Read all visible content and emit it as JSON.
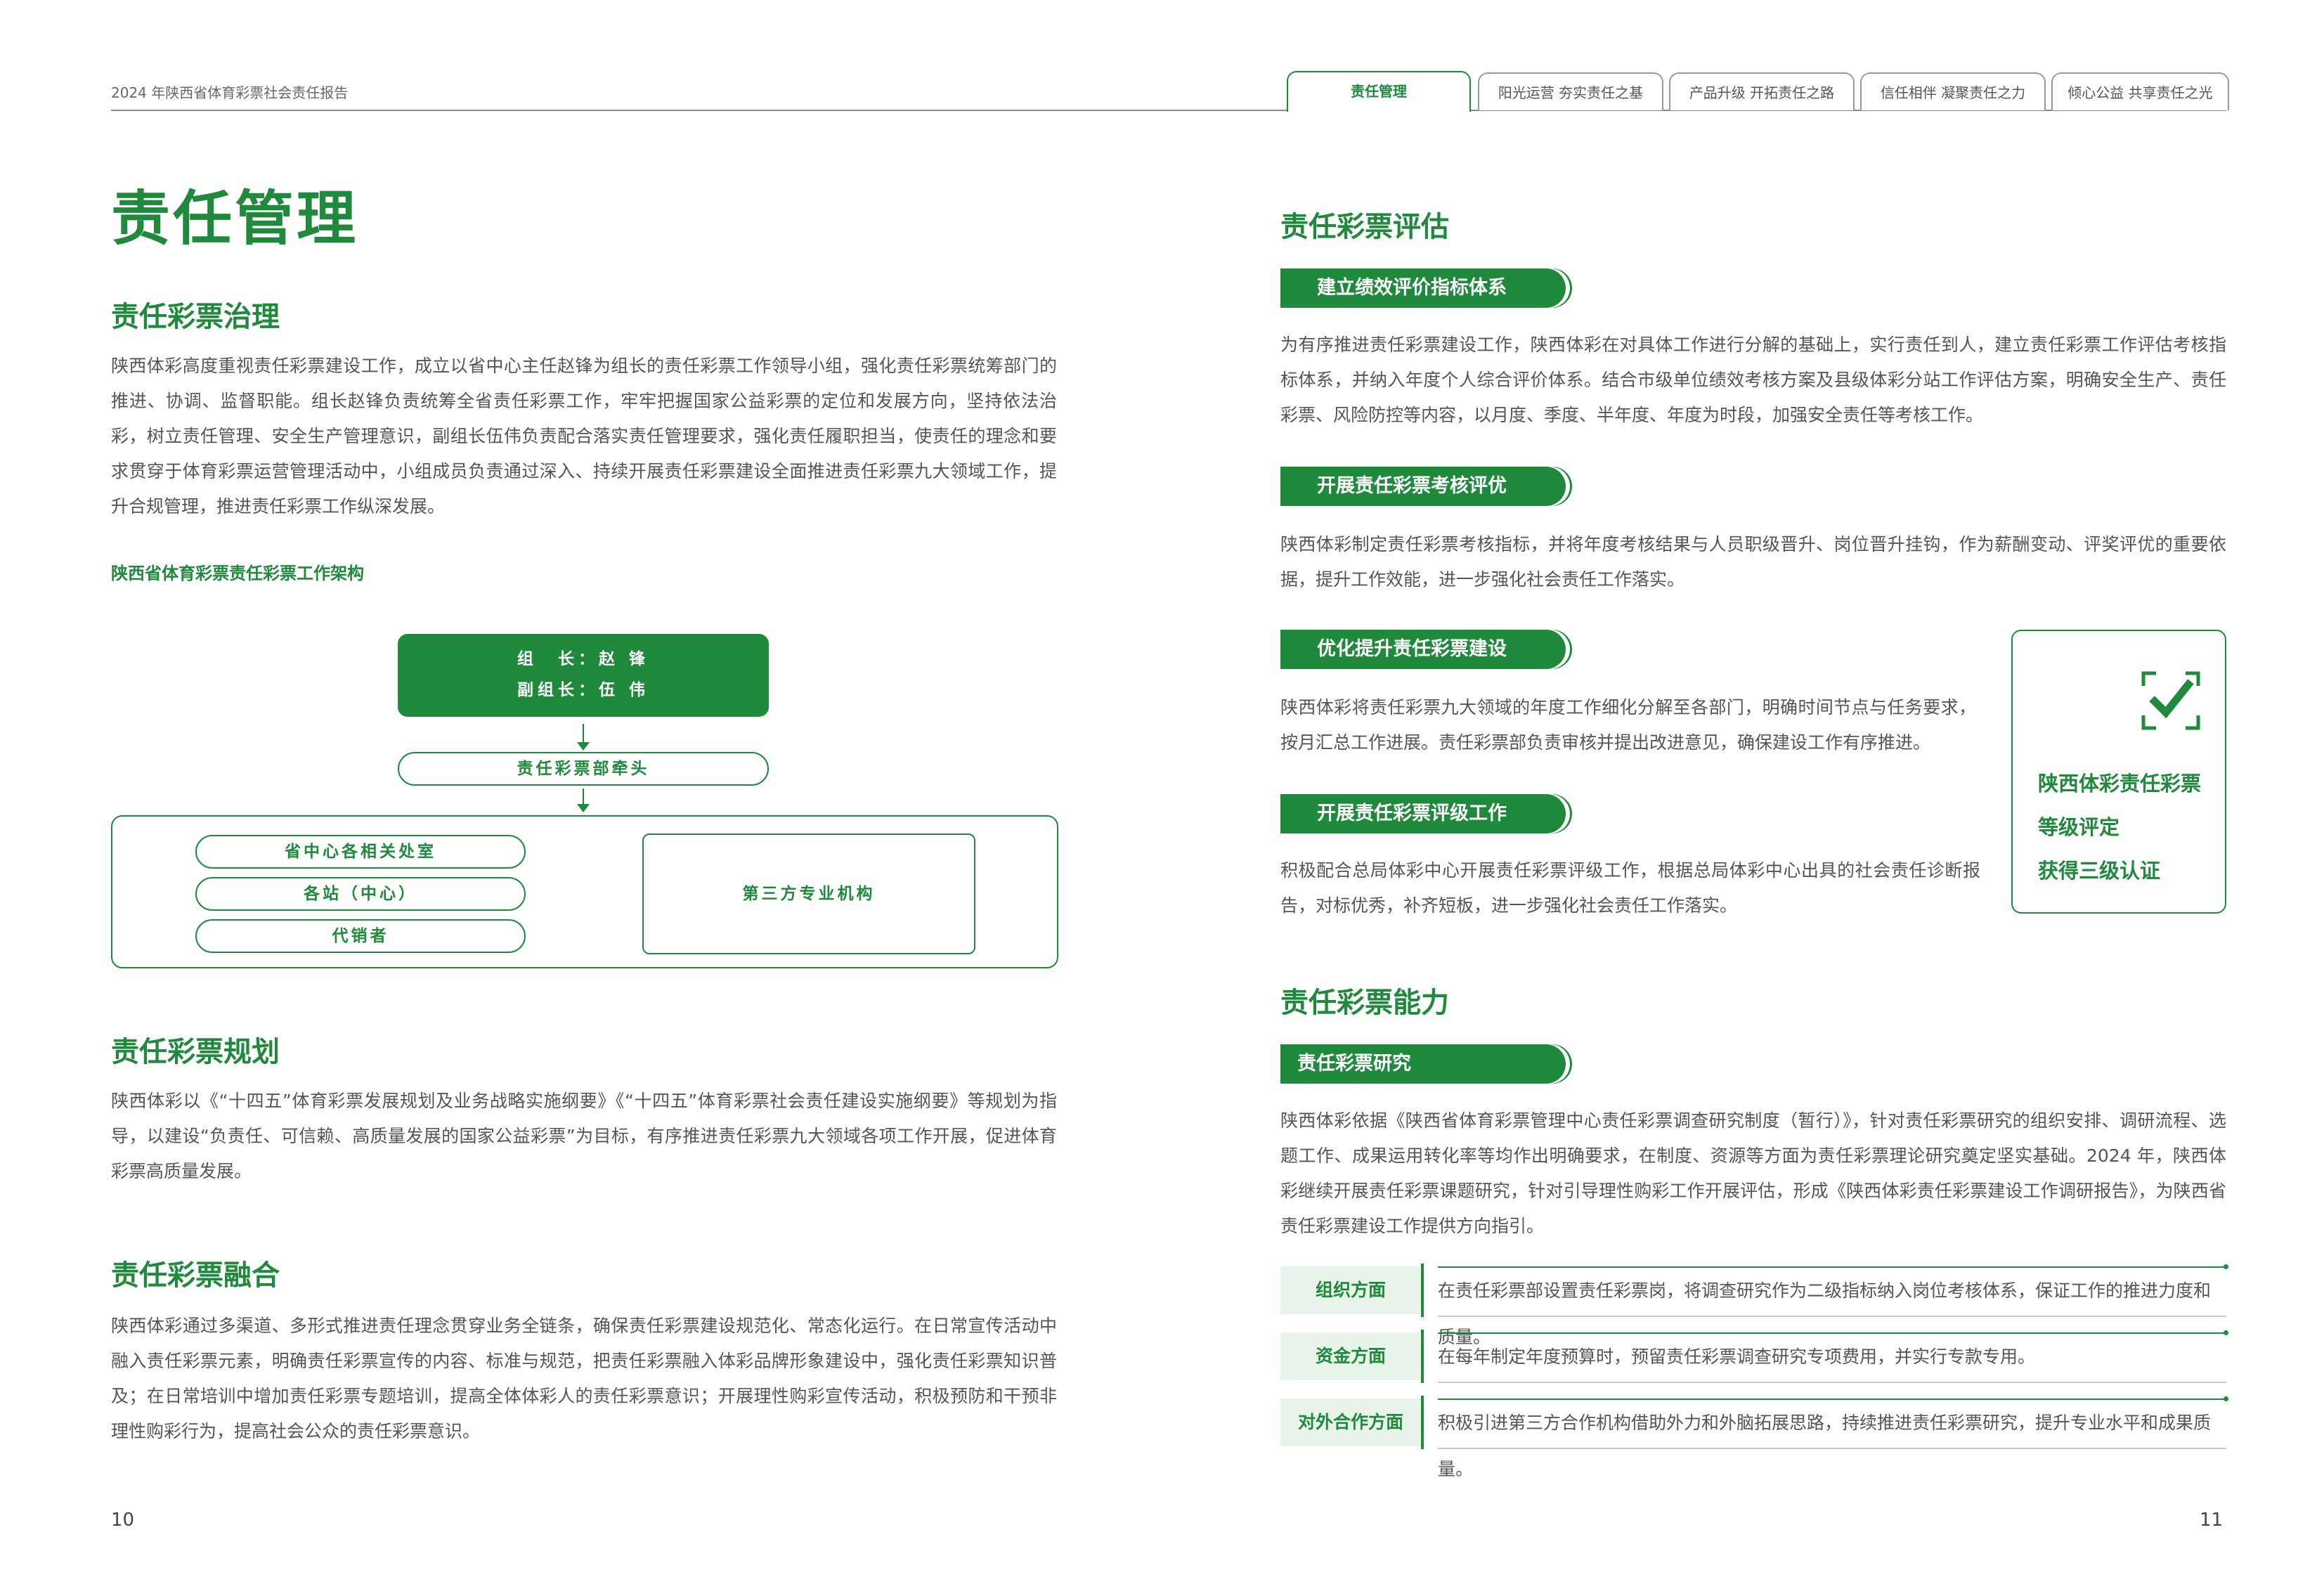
{
  "header": {
    "report_title": "2024 年陕西省体育彩票社会责任报告",
    "tabs": [
      {
        "label": "责任管理",
        "active": true
      },
      {
        "label": "阳光运营  夯实责任之基",
        "active": false
      },
      {
        "label": "产品升级  开拓责任之路",
        "active": false
      },
      {
        "label": "信任相伴  凝聚责任之力",
        "active": false
      },
      {
        "label": "倾心公益  共享责任之光",
        "active": false
      }
    ]
  },
  "left": {
    "page_title": "责任管理",
    "governance": {
      "heading": "责任彩票治理",
      "paragraph": "陕西体彩高度重视责任彩票建设工作，成立以省中心主任赵锋为组长的责任彩票工作领导小组，强化责任彩票统筹部门的推进、协调、监督职能。组长赵锋负责统筹全省责任彩票工作，牢牢把握国家公益彩票的定位和发展方向，坚持依法治彩，树立责任管理、安全生产管理意识，副组长伍伟负责配合落实责任管理要求，强化责任履职担当，使责任的理念和要求贯穿于体育彩票运营管理活动中，小组成员负责通过深入、持续开展责任彩票建设全面推进责任彩票九大领域工作，提升合规管理，推进责任彩票工作纵深发展。",
      "chart_caption": "陕西省体育彩票责任彩票工作架构",
      "org": {
        "leader": "组　长：赵 锋",
        "deputy": "副组长：伍 伟",
        "lead_dept": "责任彩票部牵头",
        "units": [
          "省中心各相关处室",
          "各站（中心）",
          "代销者"
        ],
        "third_party": "第三方专业机构"
      }
    },
    "planning": {
      "heading": "责任彩票规划",
      "paragraph": "陕西体彩以《“十四五”体育彩票发展规划及业务战略实施纲要》《“十四五”体育彩票社会责任建设实施纲要》等规划为指导，以建设“负责任、可信赖、高质量发展的国家公益彩票”为目标，有序推进责任彩票九大领域各项工作开展，促进体育彩票高质量发展。"
    },
    "integration": {
      "heading": "责任彩票融合",
      "paragraph": "陕西体彩通过多渠道、多形式推进责任理念贯穿业务全链条，确保责任彩票建设规范化、常态化运行。在日常宣传活动中融入责任彩票元素，明确责任彩票宣传的内容、标准与规范，把责任彩票融入体彩品牌形象建设中，强化责任彩票知识普及；在日常培训中增加责任彩票专题培训，提高全体体彩人的责任彩票意识；开展理性购彩宣传活动，积极预防和干预非理性购彩行为，提高社会公众的责任彩票意识。"
    },
    "page_number": "10"
  },
  "right": {
    "evaluation": {
      "heading": "责任彩票评估",
      "items": [
        {
          "title": "建立绩效评价指标体系",
          "text": "为有序推进责任彩票建设工作，陕西体彩在对具体工作进行分解的基础上，实行责任到人，建立责任彩票工作评估考核指标体系，并纳入年度个人综合评价体系。结合市级单位绩效考核方案及县级体彩分站工作评估方案，明确安全生产、责任彩票、风险防控等内容，以月度、季度、半年度、年度为时段，加强安全责任等考核工作。"
        },
        {
          "title": "开展责任彩票考核评优",
          "text": "陕西体彩制定责任彩票考核指标，并将年度考核结果与人员职级晋升、岗位晋升挂钩，作为薪酬变动、评奖评优的重要依据，提升工作效能，进一步强化社会责任工作落实。"
        },
        {
          "title": "优化提升责任彩票建设",
          "text": "陕西体彩将责任彩票九大领域的年度工作细化分解至各部门，明确时间节点与任务要求，按月汇总工作进展。责任彩票部负责审核并提出改进意见，确保建设工作有序推进。"
        },
        {
          "title": "开展责任彩票评级工作",
          "text": "积极配合总局体彩中心开展责任彩票评级工作，根据总局体彩中心出具的社会责任诊断报告，对标优秀，补齐短板，进一步强化社会责任工作落实。"
        }
      ],
      "cert": {
        "icon": "check-scan-icon",
        "lines": [
          "陕西体彩责任彩票",
          "等级评定",
          "获得三级认证"
        ]
      }
    },
    "capability": {
      "heading": "责任彩票能力",
      "pill": "责任彩票研究",
      "paragraph": "陕西体彩依据《陕西省体育彩票管理中心责任彩票调查研究制度（暂行）》，针对责任彩票研究的组织安排、调研流程、选题工作、成果运用转化率等均作出明确要求，在制度、资源等方面为责任彩票理论研究奠定坚实基础。2024 年，陕西体彩继续开展责任彩票课题研究，针对引导理性购彩工作开展评估，形成《陕西体彩责任彩票建设工作调研报告》，为陕西省责任彩票建设工作提供方向指引。",
      "rows": [
        {
          "label": "组织方面",
          "text": "在责任彩票部设置责任彩票岗，将调查研究作为二级指标纳入岗位考核体系，保证工作的推进力度和质量。"
        },
        {
          "label": "资金方面",
          "text": "在每年制定年度预算时，预留责任彩票调查研究专项费用，并实行专款专用。"
        },
        {
          "label": "对外合作方面",
          "text": "积极引进第三方合作机构借助外力和外脑拓展思路，持续推进责任彩票研究，提升专业水平和成果质量。"
        }
      ]
    },
    "page_number": "11"
  },
  "colors": {
    "brand_green": "#1f8a3c",
    "light_green": "#e8f3e9",
    "text": "#555555"
  }
}
